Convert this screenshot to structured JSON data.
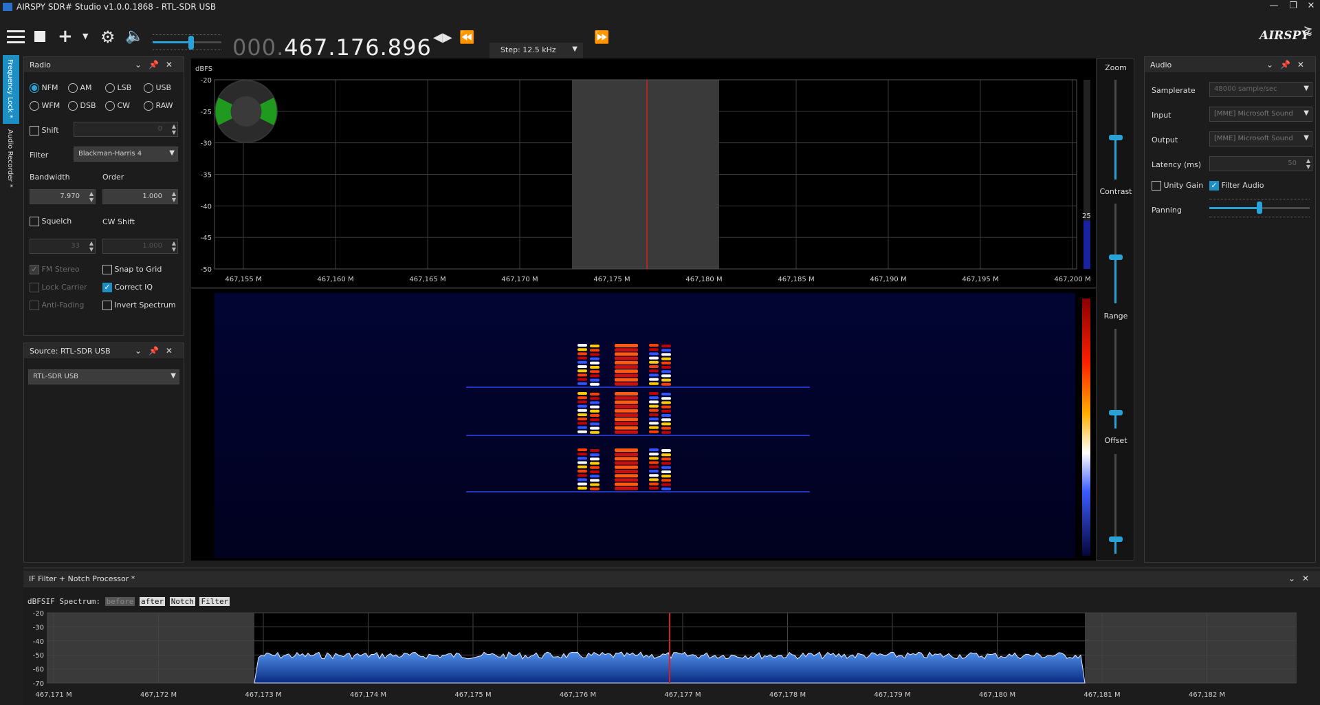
{
  "app": {
    "title": "AIRSPY SDR# Studio v1.0.0.1868 - RTL-SDR USB",
    "brand": "AIRSPY"
  },
  "toolbar": {
    "freq_dim": "000.",
    "freq_main": "467.176.896",
    "step_label": "Step: 12.5 kHz"
  },
  "side_tabs": [
    "Frequency Lock *",
    "Audio Recorder *"
  ],
  "radio_panel": {
    "title": "Radio",
    "modes": [
      {
        "label": "NFM",
        "selected": true
      },
      {
        "label": "AM",
        "selected": false
      },
      {
        "label": "LSB",
        "selected": false
      },
      {
        "label": "USB",
        "selected": false
      },
      {
        "label": "WFM",
        "selected": false
      },
      {
        "label": "DSB",
        "selected": false
      },
      {
        "label": "CW",
        "selected": false
      },
      {
        "label": "RAW",
        "selected": false
      }
    ],
    "shift_label": "Shift",
    "shift_value": "0",
    "filter_label": "Filter",
    "filter_value": "Blackman-Harris 4",
    "bandwidth_label": "Bandwidth",
    "bandwidth_value": "7.970",
    "order_label": "Order",
    "order_value": "1.000",
    "squelch_label": "Squelch",
    "squelch_value": "33",
    "cwshift_label": "CW Shift",
    "cwshift_value": "1.000",
    "fm_stereo": "FM Stereo",
    "snap_to_grid": "Snap to Grid",
    "lock_carrier": "Lock Carrier",
    "correct_iq": "Correct IQ",
    "anti_fading": "Anti-Fading",
    "invert_spectrum": "Invert Spectrum"
  },
  "source_panel": {
    "title": "Source: RTL-SDR USB",
    "device": "RTL-SDR USB"
  },
  "audio_panel": {
    "title": "Audio",
    "samplerate_label": "Samplerate",
    "samplerate_value": "48000 sample/sec",
    "input_label": "Input",
    "input_value": "[MME] Microsoft Sound",
    "output_label": "Output",
    "output_value": "[MME] Microsoft Sound",
    "latency_label": "Latency (ms)",
    "latency_value": "50",
    "unity_gain": "Unity Gain",
    "filter_audio": "Filter Audio",
    "panning_label": "Panning"
  },
  "spectrum": {
    "unit": "dBFS",
    "y_ticks": [
      "-20",
      "-25",
      "-30",
      "-35",
      "-40",
      "-45",
      "-50"
    ],
    "x_ticks": [
      "467,155 M",
      "467,160 M",
      "467,165 M",
      "467,170 M",
      "467,175 M",
      "467,180 M",
      "467,185 M",
      "467,190 M",
      "467,195 M",
      "467,200 M"
    ],
    "gain_marker": "25"
  },
  "sliders": {
    "zoom": "Zoom",
    "contrast": "Contrast",
    "range": "Range",
    "offset": "Offset"
  },
  "if_panel": {
    "title": "IF Filter + Notch Processor *",
    "header_text": "dBFSIF Spectrum:",
    "buttons": [
      "before",
      "after",
      "Notch",
      "Filter"
    ],
    "y_ticks": [
      "-20",
      "-30",
      "-40",
      "-50",
      "-60",
      "-70"
    ],
    "x_ticks": [
      "467,171 M",
      "467,172 M",
      "467,173 M",
      "467,174 M",
      "467,175 M",
      "467,176 M",
      "467,177 M",
      "467,178 M",
      "467,179 M",
      "467,180 M",
      "467,181 M",
      "467,182 M"
    ]
  },
  "colors": {
    "accent": "#29a3d7",
    "tuner_line": "#d42020",
    "ring_green": "#1f9a1f"
  }
}
